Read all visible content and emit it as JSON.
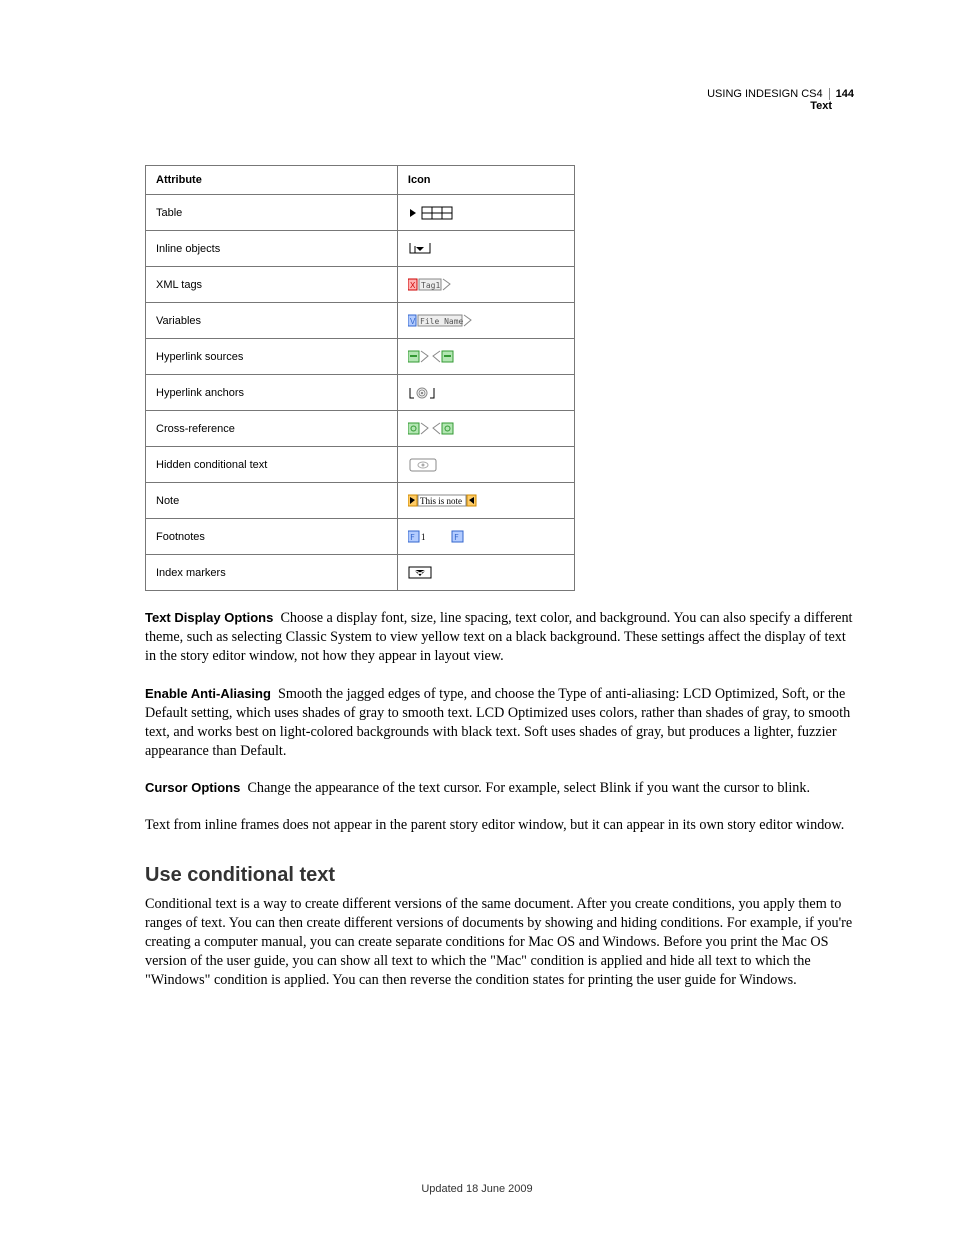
{
  "header": {
    "doc_title": "USING INDESIGN CS4",
    "page_num": "144",
    "section": "Text"
  },
  "table": {
    "head_col1": "Attribute",
    "head_col2": "Icon",
    "rows": [
      {
        "label": "Table"
      },
      {
        "label": "Inline objects"
      },
      {
        "label": "XML tags"
      },
      {
        "label": "Variables"
      },
      {
        "label": "Hyperlink sources"
      },
      {
        "label": "Hyperlink anchors"
      },
      {
        "label": "Cross-reference"
      },
      {
        "label": "Hidden conditional text"
      },
      {
        "label": "Note"
      },
      {
        "label": "Footnotes"
      },
      {
        "label": "Index markers"
      }
    ]
  },
  "body": {
    "p1_lead": "Text Display Options",
    "p1": "Choose a display font, size, line spacing, text color, and background. You can also specify a different theme, such as selecting Classic System to view yellow text on a black background. These settings affect the display of text in the story editor window, not how they appear in layout view.",
    "p2_lead": "Enable Anti-Aliasing",
    "p2": "Smooth the jagged edges of type, and choose the Type of anti-aliasing: LCD Optimized, Soft, or the Default setting, which uses shades of gray to smooth text. LCD Optimized uses colors, rather than shades of gray, to smooth text, and works best on light-colored backgrounds with black text. Soft uses shades of gray, but produces a lighter, fuzzier appearance than Default.",
    "p3_lead": "Cursor Options",
    "p3": "Change the appearance of the text cursor. For example, select Blink if you want the cursor to blink.",
    "p4": "Text from inline frames does not appear in the parent story editor window, but it can appear in its own story editor window.",
    "h2": "Use conditional text",
    "p5": "Conditional text is a way to create different versions of the same document. After you create conditions, you apply them to ranges of text. You can then create different versions of documents by showing and hiding conditions. For example, if you're creating a computer manual, you can create separate conditions for Mac OS and Windows. Before you print the Mac OS version of the user guide, you can show all text to which the \"Mac\" condition is applied and hide all text to which the \"Windows\" condition is applied. You can then reverse the condition states for printing the user guide for Windows."
  },
  "footer": {
    "updated": "Updated 18 June 2009"
  }
}
